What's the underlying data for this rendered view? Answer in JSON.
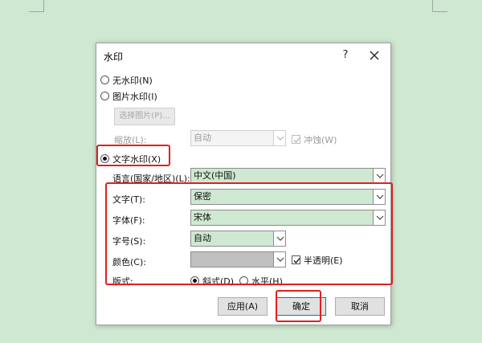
{
  "dialog": {
    "title": "水印",
    "help_label": "?",
    "options": {
      "no_watermark": "无水印(N)",
      "picture_watermark": "图片水印(I)",
      "select_picture": "选择图片(P)...",
      "scale_label": "缩放(L):",
      "scale_value": "自动",
      "washout_label": "冲蚀(W)",
      "text_watermark": "文字水印(X)"
    },
    "fields": {
      "language_label": "语言(国家/地区)(L):",
      "language_value": "中文(中国)",
      "text_label": "文字(T):",
      "text_value": "保密",
      "font_label": "字体(F):",
      "font_value": "宋体",
      "size_label": "字号(S):",
      "size_value": "自动",
      "color_label": "颜色(C):",
      "color_value": "#c0c0c0",
      "semitransparent_label": "半透明(E)",
      "layout_label": "版式:",
      "diagonal_label": "斜式(D)",
      "horizontal_label": "水平(H)"
    },
    "buttons": {
      "apply": "应用(A)",
      "ok": "确定",
      "cancel": "取消"
    },
    "state": {
      "selected_option": "text_watermark",
      "layout": "diagonal",
      "semitransparent": true,
      "washout": true
    }
  },
  "colors": {
    "background": "#cfe8d2",
    "field_fill": "#cfe8d2",
    "annotation": "#e02020",
    "default_button_border": "#0078d7"
  }
}
